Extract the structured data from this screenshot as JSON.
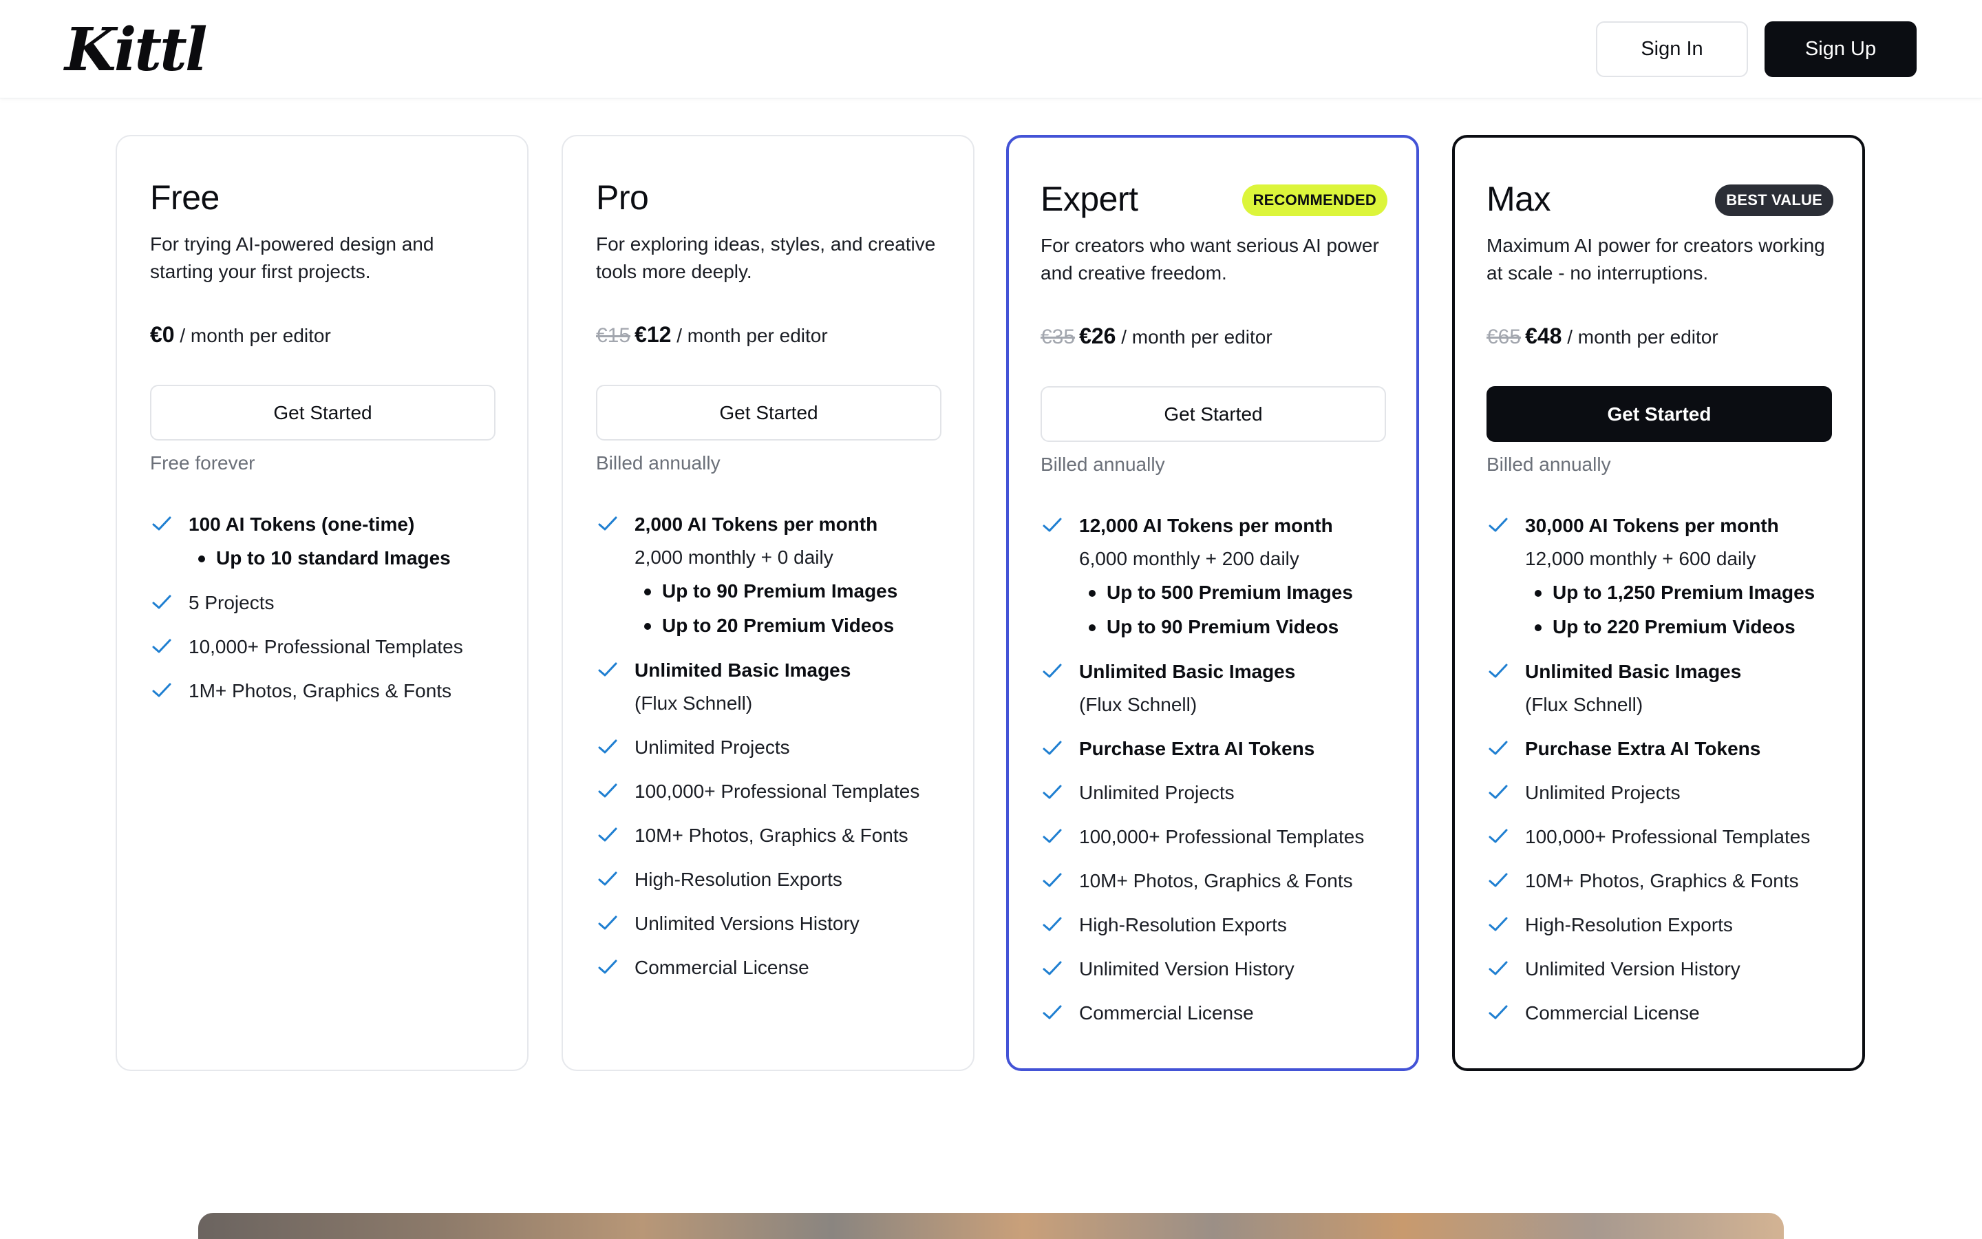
{
  "header": {
    "logo_text": "Kittl",
    "sign_in_label": "Sign In",
    "sign_up_label": "Sign Up"
  },
  "colors": {
    "accent_blue": "#4353d6",
    "check_blue": "#1f7fd1",
    "recommended_badge": "#dcf53b",
    "dark": "#0b0d12"
  },
  "plans": [
    {
      "name": "Free",
      "badge": "",
      "description": "For trying AI-powered design and starting your first projects.",
      "price_old": "",
      "price": "€0",
      "price_unit": " / month per editor",
      "cta": "Get Started",
      "billing": "Free forever",
      "features": {
        "f0": {
          "text": "100 AI Tokens (one-time)",
          "bullets": [
            "Up to 10 standard Images"
          ]
        },
        "f1": {
          "text": "5 Projects"
        },
        "f2": {
          "text": "10,000+ Professional Templates"
        },
        "f3": {
          "text": "1M+ Photos, Graphics & Fonts"
        }
      }
    },
    {
      "name": "Pro",
      "badge": "",
      "description": "For exploring ideas, styles, and creative tools more deeply.",
      "price_old": "€15",
      "price": "€12",
      "price_unit": " / month per editor",
      "cta": "Get Started",
      "billing": "Billed annually",
      "features": {
        "f0": {
          "text": "2,000 AI Tokens per month",
          "sub": "2,000 monthly + 0 daily",
          "bullets": [
            "Up to 90 Premium Images",
            "Up to 20 Premium Videos"
          ]
        },
        "f1": {
          "text": "Unlimited Basic Images",
          "sub": "(Flux Schnell)"
        },
        "f2": {
          "text": "Unlimited Projects"
        },
        "f3": {
          "text": "100,000+ Professional Templates"
        },
        "f4": {
          "text": "10M+ Photos, Graphics & Fonts"
        },
        "f5": {
          "text": "High-Resolution Exports"
        },
        "f6": {
          "text": "Unlimited Versions History"
        },
        "f7": {
          "text": "Commercial License"
        }
      }
    },
    {
      "name": "Expert",
      "badge": "RECOMMENDED",
      "description": "For creators who want serious AI power and creative freedom.",
      "price_old": "€35",
      "price": "€26",
      "price_unit": " / month per editor",
      "cta": "Get Started",
      "billing": "Billed annually",
      "features": {
        "f0": {
          "text": "12,000 AI Tokens per month",
          "sub": "6,000 monthly + 200 daily",
          "bullets": [
            "Up to 500 Premium Images",
            "Up to 90 Premium Videos"
          ]
        },
        "f1": {
          "text": "Unlimited Basic Images",
          "sub": "(Flux Schnell)"
        },
        "f2": {
          "text": "Purchase Extra AI Tokens"
        },
        "f3": {
          "text": "Unlimited Projects"
        },
        "f4": {
          "text": "100,000+ Professional Templates"
        },
        "f5": {
          "text": "10M+ Photos, Graphics & Fonts"
        },
        "f6": {
          "text": "High-Resolution Exports"
        },
        "f7": {
          "text": "Unlimited Version History"
        },
        "f8": {
          "text": "Commercial License"
        }
      }
    },
    {
      "name": "Max",
      "badge": "BEST VALUE",
      "description": "Maximum AI power for creators working at scale - no interruptions.",
      "price_old": "€65",
      "price": "€48",
      "price_unit": " / month per editor",
      "cta": "Get Started",
      "billing": "Billed annually",
      "features": {
        "f0": {
          "text": "30,000 AI Tokens per month",
          "sub": "12,000 monthly + 600 daily",
          "bullets": [
            "Up to 1,250 Premium Images",
            "Up to 220 Premium Videos"
          ]
        },
        "f1": {
          "text": "Unlimited Basic Images",
          "sub": "(Flux Schnell)"
        },
        "f2": {
          "text": "Purchase Extra AI Tokens"
        },
        "f3": {
          "text": "Unlimited Projects"
        },
        "f4": {
          "text": "100,000+ Professional Templates"
        },
        "f5": {
          "text": "10M+ Photos, Graphics & Fonts"
        },
        "f6": {
          "text": "High-Resolution Exports"
        },
        "f7": {
          "text": "Unlimited Version History"
        },
        "f8": {
          "text": "Commercial License"
        }
      }
    }
  ]
}
